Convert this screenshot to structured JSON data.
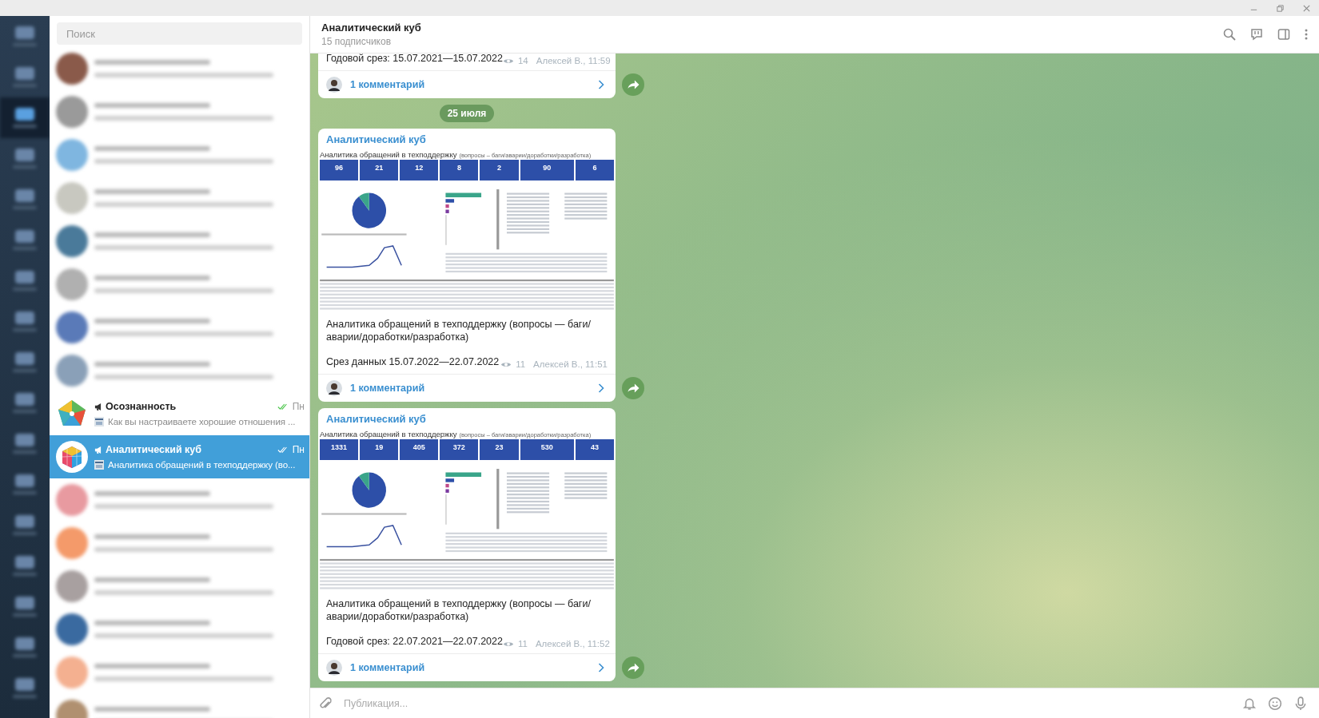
{
  "folders": [
    {
      "selected": false
    },
    {
      "selected": false
    },
    {
      "selected": true
    },
    {
      "selected": false
    },
    {
      "selected": false
    },
    {
      "selected": false
    },
    {
      "selected": false
    },
    {
      "selected": false
    },
    {
      "selected": false
    },
    {
      "selected": false
    },
    {
      "selected": false
    },
    {
      "selected": false
    },
    {
      "selected": false
    },
    {
      "selected": false
    },
    {
      "selected": false
    },
    {
      "selected": false
    },
    {
      "selected": false
    }
  ],
  "search": {
    "placeholder": "Поиск"
  },
  "chats": [
    {
      "kind": "blurred",
      "color": "#8a5a4a",
      "selected": false
    },
    {
      "kind": "blurred",
      "color": "#9a9a9a",
      "selected": false
    },
    {
      "kind": "blurred",
      "color": "#7fb6e0",
      "selected": false
    },
    {
      "kind": "blurred",
      "color": "#c8c8c0",
      "selected": false
    },
    {
      "kind": "blurred",
      "color": "#4a7a9a",
      "selected": false
    },
    {
      "kind": "blurred",
      "color": "#b0b0b0",
      "selected": false
    },
    {
      "kind": "blurred",
      "color": "#5a7ab8",
      "selected": false
    },
    {
      "kind": "blurred",
      "color": "#8aa0b8",
      "selected": false
    },
    {
      "kind": "channel",
      "name": "Осознанность",
      "time": "Пн",
      "preview": "Как вы настраиваете хорошие отношения ...",
      "selected": false
    },
    {
      "kind": "channel",
      "name": "Аналитический куб",
      "time": "Пн",
      "preview": "Аналитика обращений в техподдержку (во...",
      "selected": true
    },
    {
      "kind": "blurred",
      "color": "#e89aa0",
      "selected": false
    },
    {
      "kind": "blurred",
      "color": "#f49a6a",
      "selected": false
    },
    {
      "kind": "blurred",
      "color": "#a8a0a0",
      "selected": false
    },
    {
      "kind": "blurred",
      "color": "#3a6aa0",
      "selected": false
    },
    {
      "kind": "blurred",
      "color": "#f4b090",
      "selected": false
    },
    {
      "kind": "blurred",
      "color": "#b09070",
      "selected": false
    }
  ],
  "header": {
    "title": "Аналитический куб",
    "subtitle": "15 подписчиков"
  },
  "messages": [
    {
      "kind": "post",
      "footer": "Годовой срез: 15.07.2021—15.07.2022",
      "views": "14",
      "signature": "Алексей В., 11:59",
      "comments": "1 комментарий"
    },
    {
      "kind": "date",
      "text": "25 июля"
    },
    {
      "kind": "post",
      "channel": "Аналитический куб",
      "report": {
        "title": "Аналитика обращений в техподдержку",
        "subtitle": "(вопросы – баги/аварии/доработки/разработка)",
        "kpis": [
          "96",
          "21",
          "12",
          "8",
          "2",
          "90",
          "6"
        ]
      },
      "caption": "Аналитика обращений в техподдержку (вопросы — баги/аварии/доработки/разработка)",
      "footer": "Срез данных 15.07.2022—22.07.2022",
      "views": "11",
      "signature": "Алексей В., 11:51",
      "comments": "1 комментарий"
    },
    {
      "kind": "post",
      "channel": "Аналитический куб",
      "report": {
        "title": "Аналитика обращений в техподдержку",
        "subtitle": "(вопросы – баги/аварии/доработки/разработка)",
        "kpis": [
          "1331",
          "19",
          "405",
          "372",
          "23",
          "530",
          "43"
        ]
      },
      "caption": "Аналитика обращений в техподдержку (вопросы — баги/аварии/доработки/разработка)",
      "footer": "Годовой срез: 22.07.2021—22.07.2022",
      "views": "11",
      "signature": "Алексей В., 11:52",
      "comments": "1 комментарий"
    }
  ],
  "composer": {
    "placeholder": "Публикация..."
  }
}
